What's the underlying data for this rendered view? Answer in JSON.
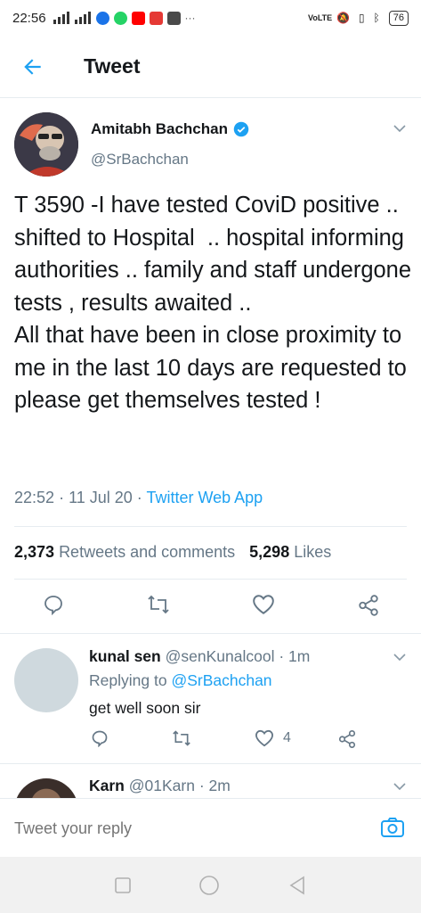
{
  "status_bar": {
    "time": "22:56",
    "network_label": "VoLTE",
    "battery": "76"
  },
  "header": {
    "title": "Tweet"
  },
  "tweet": {
    "author_name": "Amitabh Bachchan",
    "author_handle": "@SrBachchan",
    "text": "T 3590 -I have tested CoviD positive ..  shifted to Hospital  .. hospital informing  authorities .. family and staff undergone tests , results awaited ..\nAll that have been in close proximity to me in the last 10 days are requested to please get themselves tested !",
    "time": "22:52",
    "date": "11 Jul 20",
    "source": "Twitter Web App",
    "retweets_count": "2,373",
    "retweets_label": "Retweets and comments",
    "likes_count": "5,298",
    "likes_label": "Likes"
  },
  "replies": [
    {
      "name": "kunal sen",
      "handle": "@senKunalcool",
      "age": "1m",
      "replying_prefix": "Replying to",
      "replying_to": "@SrBachchan",
      "text": "get well soon sir",
      "likes": "4"
    },
    {
      "name": "Karn",
      "handle": "@01Karn",
      "age": "2m"
    }
  ],
  "compose": {
    "placeholder": "Tweet your reply"
  },
  "colors": {
    "accent": "#1da1f2",
    "secondary_text": "#657786",
    "primary_text": "#14171a"
  }
}
